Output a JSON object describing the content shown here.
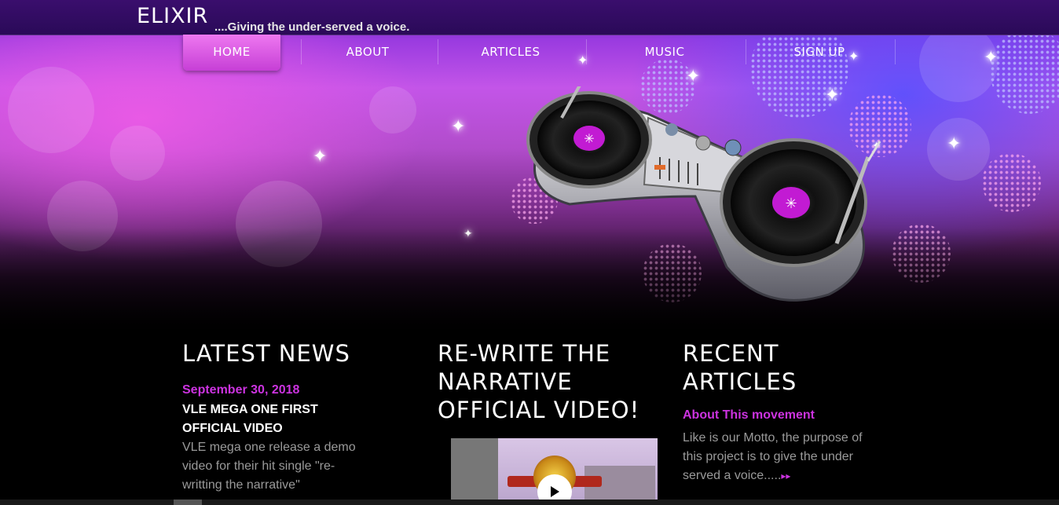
{
  "site": {
    "logo": "ELIXIR",
    "tagline": "....Giving the under-served a voice."
  },
  "nav": {
    "items": [
      {
        "label": "HOME",
        "active": true
      },
      {
        "label": "ABOUT",
        "active": false
      },
      {
        "label": "ARTICLES",
        "active": false
      },
      {
        "label": "MUSIC",
        "active": false
      },
      {
        "label": "SIGN UP",
        "active": false
      }
    ]
  },
  "hero": {
    "illustration": "dj-turntable-mixer"
  },
  "latest_news": {
    "heading": "LATEST NEWS",
    "date": "September 30, 2018",
    "title_line1": "VLE MEGA ONE FIRST",
    "title_line2": "OFFICIAL VIDEO",
    "body_line1": "VLE mega one release a demo",
    "body_line2": "video for their hit single \"re-",
    "body_line3": "writting the narrative\""
  },
  "video_section": {
    "heading_line1": "RE-WRITE THE",
    "heading_line2": "NARRATIVE",
    "heading_line3": "OFFICIAL VIDEO!",
    "play_icon": "play-icon"
  },
  "recent_articles": {
    "heading": "RECENT ARTICLES",
    "article_title": "About This movement",
    "body_line1": "Like is our Motto, the purpose of",
    "body_line2": "this project is to give the under",
    "body_line3": "served a voice.....",
    "more_icon": "double-chevron-right-icon"
  },
  "colors": {
    "accent": "#cc33e0",
    "nav_active": "#e065ea",
    "background": "#000000"
  }
}
